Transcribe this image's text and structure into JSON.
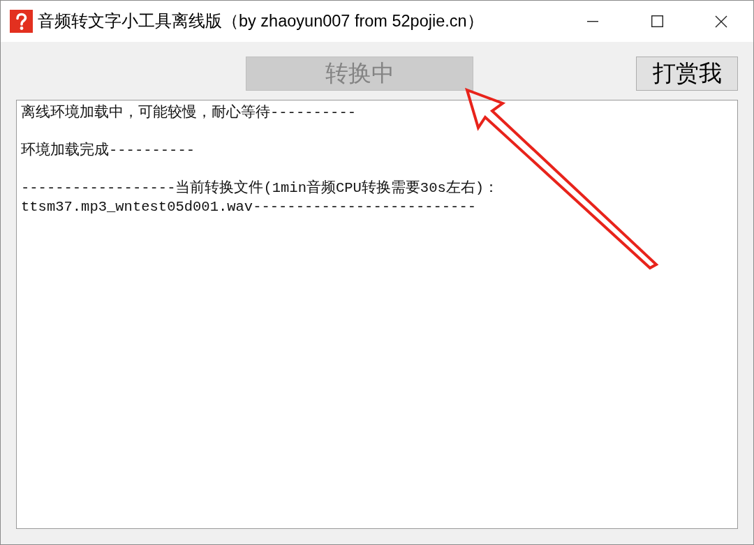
{
  "window": {
    "title": "音频转文字小工具离线版（by zhaoyun007 from 52pojie.cn）"
  },
  "convert_button": {
    "label": "转换中",
    "disabled": true
  },
  "reward_button": {
    "label": "打赏我",
    "disabled": false
  },
  "log": {
    "text": "离线环境加载中，可能较慢，耐心等待----------\n\n环境加载完成----------\n\n------------------当前转换文件(1min音频CPU转换需要30s左右)：\nttsm37.mp3_wntest05d001.wav--------------------------"
  }
}
